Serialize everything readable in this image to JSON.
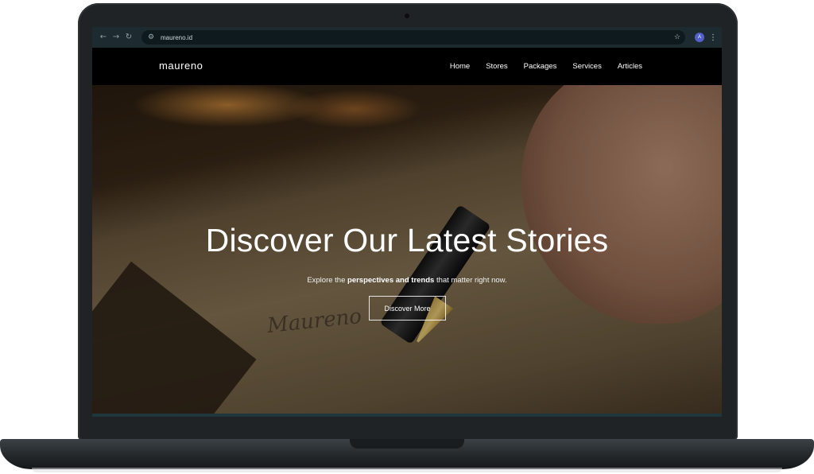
{
  "browser": {
    "url": "maureno.id",
    "profile_initial": "A"
  },
  "site": {
    "brand": "maureno",
    "nav": [
      "Home",
      "Stores",
      "Packages",
      "Services",
      "Articles"
    ]
  },
  "hero": {
    "title": "Discover Our Latest Stories",
    "subtitle_prefix": "Explore the ",
    "subtitle_bold": "perspectives and trends",
    "subtitle_suffix": " that matter right now.",
    "cta_label": "Discover More",
    "script_text": "Maureno"
  },
  "colors": {
    "whatsapp": "#2ac44f",
    "nav_bg": "#000000",
    "browser_bar": "#1d2b30"
  }
}
